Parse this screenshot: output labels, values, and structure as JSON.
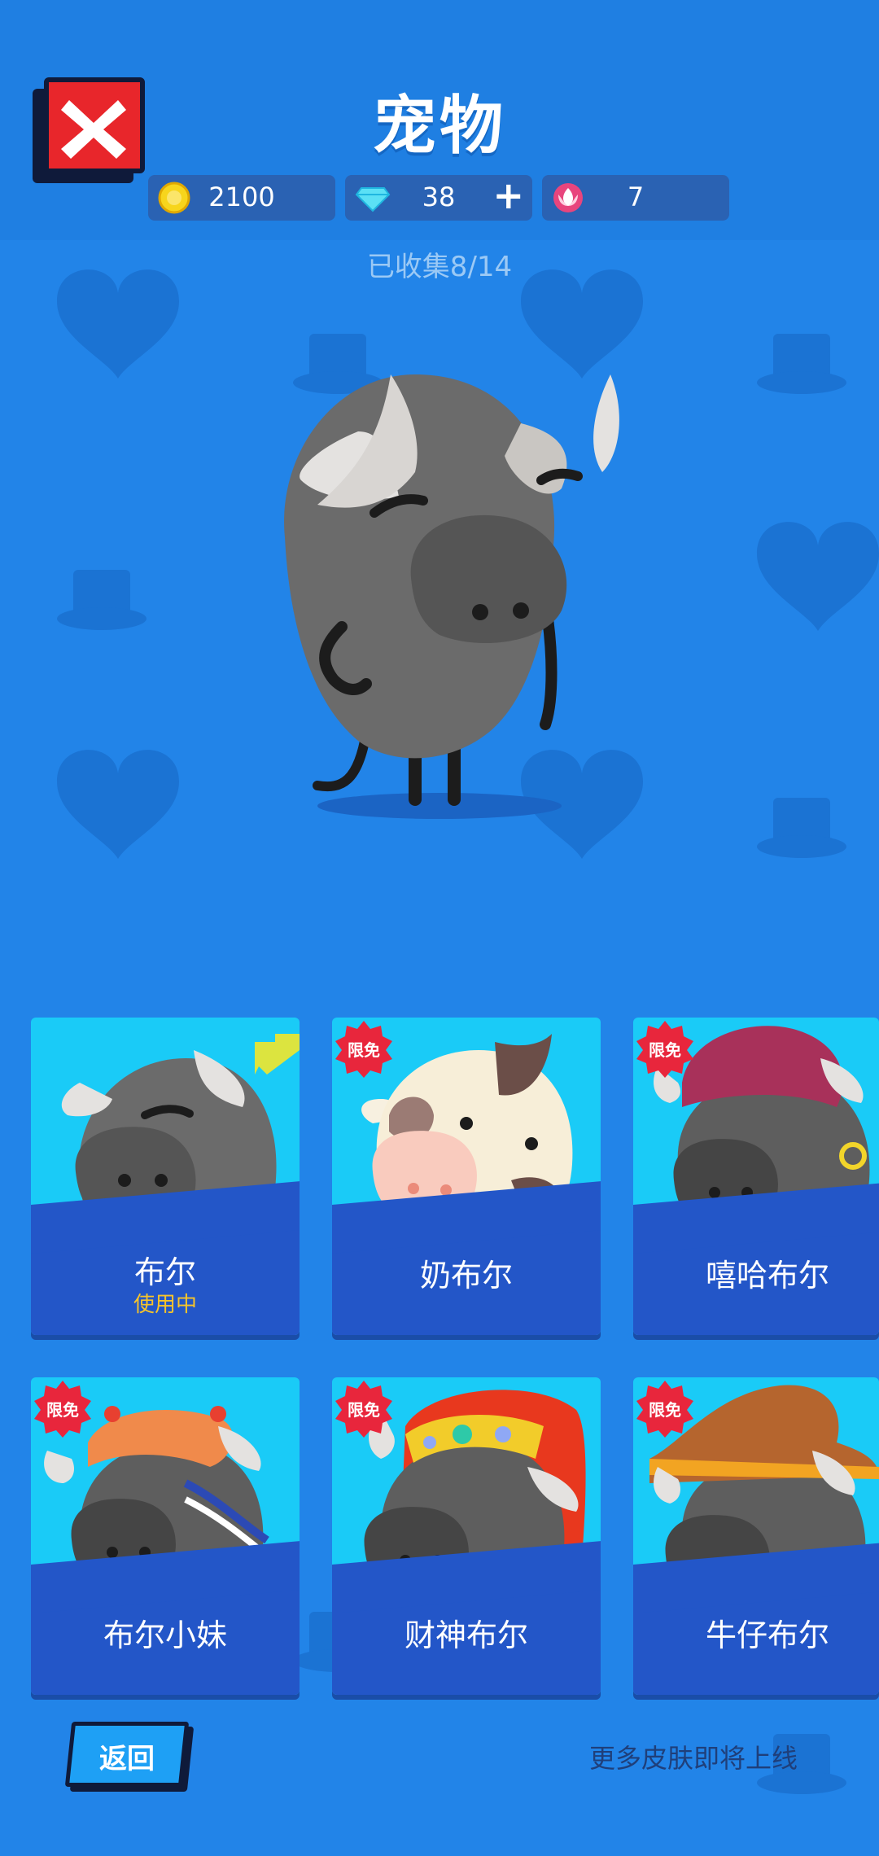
{
  "header": {
    "title": "宠物",
    "close_icon": "close-x-icon",
    "currencies": [
      {
        "icon": "gold-coin-icon",
        "value": "2100"
      },
      {
        "icon": "diamond-icon",
        "value": "38",
        "plus": "+"
      },
      {
        "icon": "lotus-icon",
        "value": "7"
      }
    ]
  },
  "collected": "已收集8/14",
  "pets": [
    {
      "name": "布尔",
      "status": "使用中"
    },
    {
      "name": "奶布尔",
      "badge": "限免"
    },
    {
      "name": "嘻哈布尔",
      "badge": "限免"
    },
    {
      "name": "布尔小妹",
      "badge": "限免"
    },
    {
      "name": "财神布尔",
      "badge": "限免"
    },
    {
      "name": "牛仔布尔",
      "badge": "限免"
    }
  ],
  "footer": {
    "back_label": "返回",
    "more_skins": "更多皮肤即将上线"
  },
  "colors": {
    "background": "#2284E8",
    "header": "#1F7FE2",
    "card": "#1ACBF7",
    "namebar": "#2356C8",
    "close": "#E8262B",
    "in_use": "#F7C42A"
  }
}
